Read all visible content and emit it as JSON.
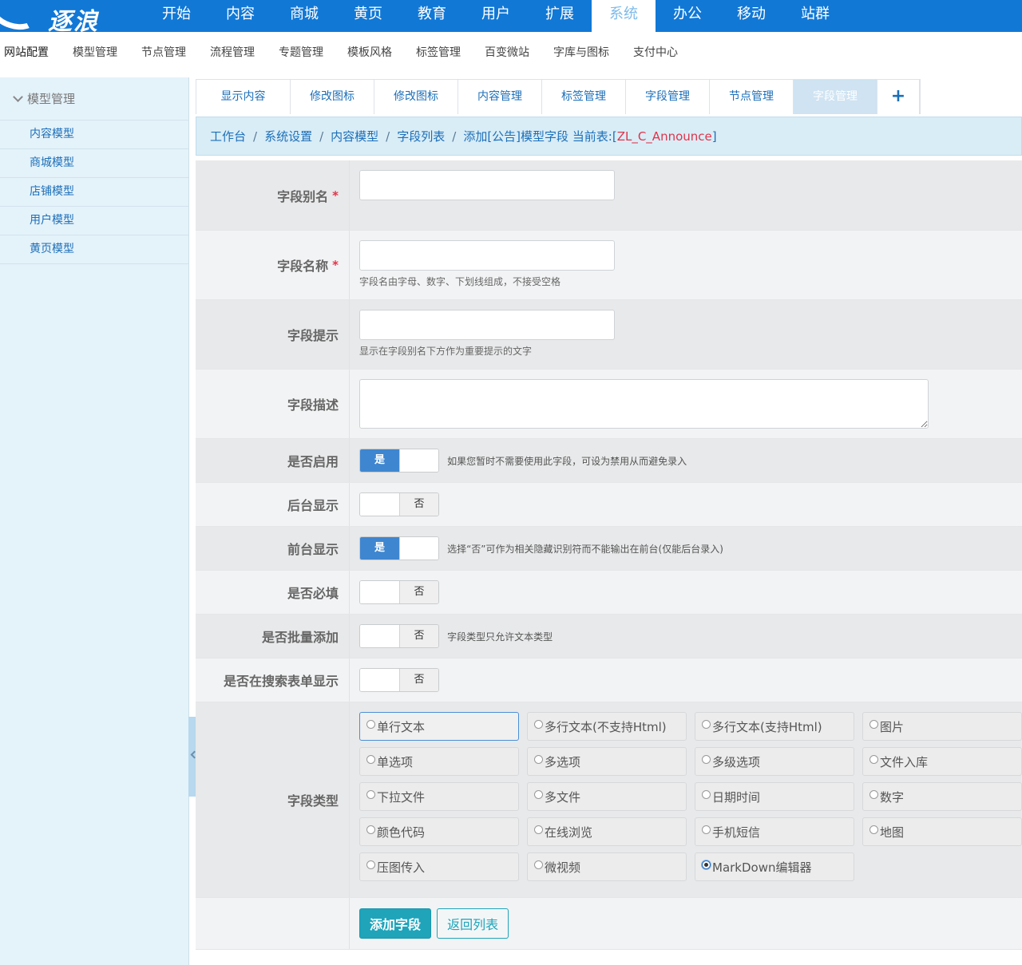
{
  "brand": {
    "logo_text": "逐浪"
  },
  "topnav": {
    "items": [
      "开始",
      "内容",
      "商城",
      "黄页",
      "教育",
      "用户",
      "扩展",
      "系统",
      "办公",
      "移动",
      "站群"
    ],
    "active": "系统"
  },
  "subnav": {
    "items": [
      "网站配置",
      "模型管理",
      "节点管理",
      "流程管理",
      "专题管理",
      "模板风格",
      "标签管理",
      "百变微站",
      "字库与图标",
      "支付中心"
    ]
  },
  "sidebar": {
    "group": "模型管理",
    "links": [
      "内容模型",
      "商城模型",
      "店铺模型",
      "用户模型",
      "黄页模型"
    ]
  },
  "tabs": {
    "items": [
      "显示内容",
      "修改图标",
      "修改图标",
      "内容管理",
      "标签管理",
      "字段管理",
      "节点管理",
      "字段管理"
    ],
    "active_index": 7,
    "plus": "+"
  },
  "breadcrumb": {
    "items": [
      "工作台",
      "系统设置",
      "内容模型",
      "字段列表"
    ],
    "separator": "/",
    "current": "添加[公告]模型字段 当前表:",
    "table_open": "[",
    "table": "ZL_C_Announce",
    "table_close": "]"
  },
  "form": {
    "alias": {
      "label": "字段别名",
      "required": "*",
      "value": ""
    },
    "name": {
      "label": "字段名称",
      "required": "*",
      "value": "",
      "hint": "字段名由字母、数字、下划线组成，不接受空格"
    },
    "tip": {
      "label": "字段提示",
      "value": "",
      "hint": "显示在字段别名下方作为重要提示的文字"
    },
    "desc": {
      "label": "字段描述",
      "value": ""
    },
    "enabled": {
      "label": "是否启用",
      "on_text": "是",
      "state": "on",
      "hint": "如果您暂时不需要使用此字段，可设为禁用从而避免录入"
    },
    "backend_show": {
      "label": "后台显示",
      "off_text": "否",
      "state": "off"
    },
    "frontend_show": {
      "label": "前台显示",
      "on_text": "是",
      "state": "on",
      "hint": "选择“否”可作为相关隐藏识别符而不能输出在前台(仅能后台录入)"
    },
    "required": {
      "label": "是否必填",
      "off_text": "否",
      "state": "off"
    },
    "batch_add": {
      "label": "是否批量添加",
      "off_text": "否",
      "state": "off",
      "hint": "字段类型只允许文本类型"
    },
    "search_show": {
      "label": "是否在搜索表单显示",
      "off_text": "否",
      "state": "off"
    },
    "field_type": {
      "label": "字段类型",
      "options": [
        "单行文本",
        "多行文本(不支持Html)",
        "多行文本(支持Html)",
        "图片",
        "单选项",
        "多选项",
        "多级选项",
        "文件入库",
        "下拉文件",
        "多文件",
        "日期时间",
        "数字",
        "颜色代码",
        "在线浏览",
        "手机短信",
        "地图",
        "压图传入",
        "微视频",
        "MarkDown编辑器"
      ],
      "checked": "MarkDown编辑器",
      "focused": "单行文本"
    },
    "buttons": {
      "submit": "添加字段",
      "back": "返回列表"
    }
  },
  "colors": {
    "topnav_bg": "#1178d6",
    "sidebar_bg": "#e4f2fa",
    "switch_on": "#3f86d0",
    "primary_button": "#1fa4ba",
    "required_mark": "#e0344a"
  }
}
